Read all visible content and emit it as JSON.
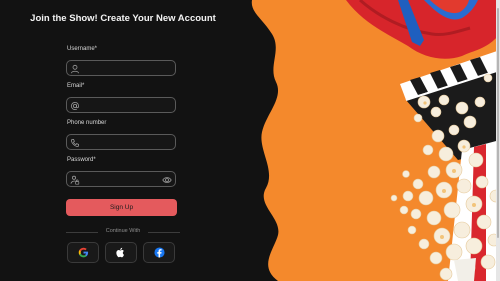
{
  "form": {
    "title": "Join the Show! Create Your New Account",
    "username_label": "Username*",
    "email_label": "Email*",
    "phone_label": "Phone number",
    "password_label": "Password*",
    "username_value": "",
    "email_value": "",
    "phone_value": "",
    "password_value": "",
    "signup_label": "Sign Up",
    "continue_with": "Continue With"
  },
  "icons": {
    "username": "user-icon",
    "email": "at-sign-icon",
    "phone": "phone-icon",
    "password": "lock-user-icon",
    "password_toggle": "eye-icon",
    "google": "google-icon",
    "apple": "apple-icon",
    "facebook": "facebook-icon"
  },
  "colors": {
    "background": "#121212",
    "accent": "#e45a5d",
    "hero_orange": "#f4892c"
  }
}
